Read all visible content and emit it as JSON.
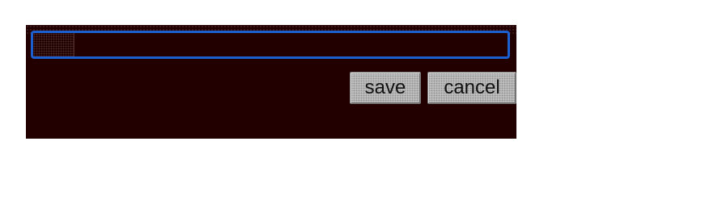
{
  "editor": {
    "input_value": "",
    "save_label": "save",
    "cancel_label": "cancel"
  },
  "colors": {
    "panel_background": "#220000",
    "focus_border": "#1c5fd0",
    "button_background": "#bdbdbd"
  }
}
